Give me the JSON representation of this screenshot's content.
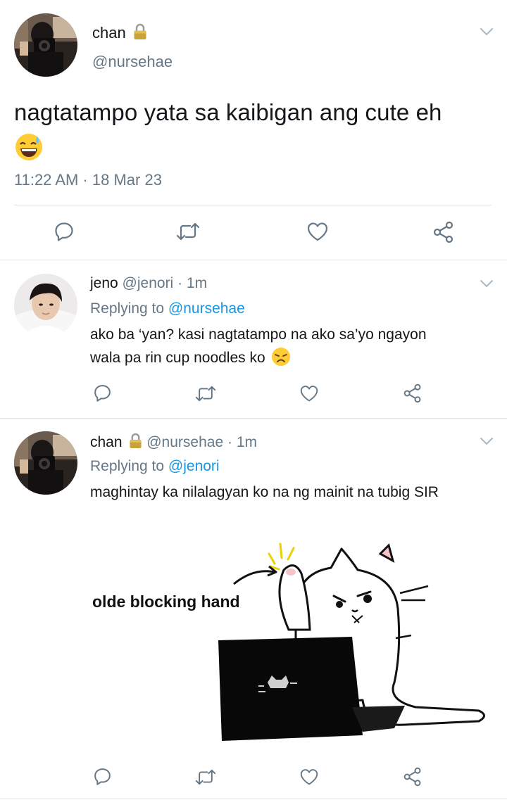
{
  "main_tweet": {
    "display_name": "chan",
    "handle": "@nursehae",
    "text": "nagtatampo yata sa kaibigan ang cute eh",
    "emoji": "grinning-face-with-sweat",
    "timestamp": "11:22 AM · 18 Mar 23"
  },
  "actions": {
    "reply": "reply-icon",
    "retweet": "retweet-icon",
    "like": "like-icon",
    "share": "share-icon"
  },
  "replies": [
    {
      "display_name": "jeno",
      "handle": "@jenori",
      "dot": "·",
      "time": "1m",
      "replying_label": "Replying to",
      "replying_to": "@nursehae",
      "lines": [
        "ako ba ‘yan? kasi nagtatampo na ako sa’yo ngayon",
        "wala pa rin cup noodles ko"
      ],
      "emoji": "disappointed-face"
    },
    {
      "display_name": "chan",
      "handle": "@nursehae",
      "dot": "·",
      "time": "1m",
      "replying_label": "Replying to",
      "replying_to": "@jenori",
      "lines": [
        "maghintay ka nilalagyan ko na ng mainit na tubig SIR"
      ],
      "media_caption": "olde blocking hand"
    }
  ],
  "colors": {
    "text": "#14171a",
    "muted": "#657786",
    "link": "#1b95e0",
    "divider": "#dfe3e8",
    "lock": "#c8a33a"
  }
}
